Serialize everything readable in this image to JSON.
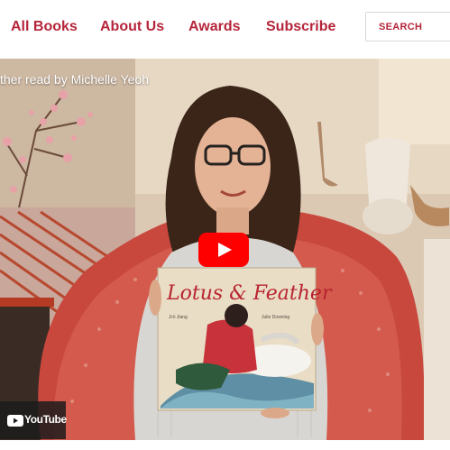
{
  "nav": {
    "items": [
      "All Books",
      "About Us",
      "Awards",
      "Subscribe"
    ],
    "search_label": "SEARCH"
  },
  "video": {
    "title_visible": "ther read by Michelle Yeoh",
    "youtube_label": "YouTube",
    "book_title": "Lotus & Feather",
    "book_author": "Ji-li Jiang",
    "book_illustrator": "Julie Downing"
  },
  "colors": {
    "brand_red": "#b5253a",
    "youtube_red": "#ff0000"
  }
}
